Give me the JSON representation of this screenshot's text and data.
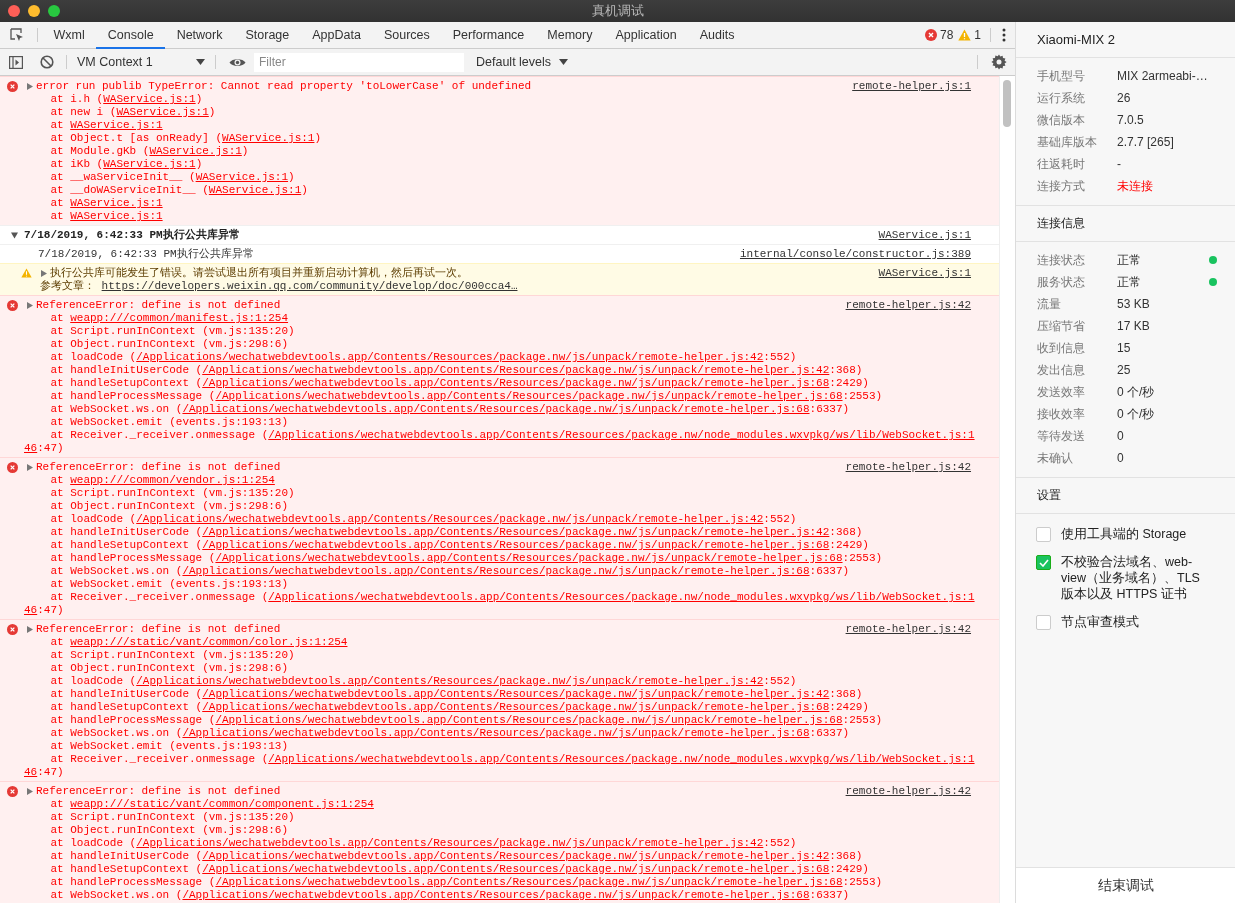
{
  "window": {
    "title": "真机调试"
  },
  "tabs": [
    {
      "label": "Wxml",
      "selected": false
    },
    {
      "label": "Console",
      "selected": true
    },
    {
      "label": "Network",
      "selected": false
    },
    {
      "label": "Storage",
      "selected": false
    },
    {
      "label": "AppData",
      "selected": false
    },
    {
      "label": "Sources",
      "selected": false
    },
    {
      "label": "Performance",
      "selected": false
    },
    {
      "label": "Memory",
      "selected": false
    },
    {
      "label": "Application",
      "selected": false
    },
    {
      "label": "Audits",
      "selected": false
    }
  ],
  "counts": {
    "errors": "78",
    "warnings": "1"
  },
  "toolbar": {
    "context": "VM Context 1",
    "filter_placeholder": "Filter",
    "levels": "Default levels"
  },
  "console": [
    {
      "kind": "error",
      "expanded": false,
      "text": "error run publib TypeError: Cannot read property 'toLowerCase' of undefined",
      "source": "remote-helper.js:1",
      "stack": [
        {
          "kind": "frame",
          "text": "at i.h (",
          "link": "WAService.js:1",
          "after": ")"
        },
        {
          "kind": "frame",
          "text": "at new i (",
          "link": "WAService.js:1",
          "after": ")"
        },
        {
          "kind": "frame",
          "text": "at ",
          "link": "WAService.js:1"
        },
        {
          "kind": "frame",
          "text": "at Object.t [as onReady] (",
          "link": "WAService.js:1",
          "after": ")"
        },
        {
          "kind": "frame",
          "text": "at Module.gKb (",
          "link": "WAService.js:1",
          "after": ")"
        },
        {
          "kind": "frame",
          "text": "at iKb (",
          "link": "WAService.js:1",
          "after": ")"
        },
        {
          "kind": "frame",
          "text": "at __waServiceInit__ (",
          "link": "WAService.js:1",
          "after": ")"
        },
        {
          "kind": "frame",
          "text": "at __doWAServiceInit__ (",
          "link": "WAService.js:1",
          "after": ")"
        },
        {
          "kind": "frame",
          "text": "at ",
          "link": "WAService.js:1"
        },
        {
          "kind": "frame",
          "text": "at ",
          "link": "WAService.js:1"
        }
      ]
    },
    {
      "kind": "group",
      "expanded": true,
      "text": "7/18/2019, 6:42:33 PM执行公共库异常",
      "source": "WAService.js:1",
      "children": [
        {
          "kind": "log",
          "text": "7/18/2019, 6:42:33 PM执行公共库异常",
          "source": "internal/console/constructor.js:389"
        },
        {
          "kind": "warning",
          "expanded": false,
          "text": "执行公共库可能发生了错误。请尝试退出所有项目并重新启动计算机，然后再试一次。",
          "ref_label": "参考文章：",
          "ref_link": "https://developers.weixin.qq.com/community/develop/doc/000cca4…",
          "source": "WAService.js:1"
        }
      ]
    },
    {
      "kind": "error",
      "expanded": false,
      "text": "ReferenceError: define is not defined",
      "source": "remote-helper.js:42",
      "stack": [
        {
          "kind": "frame",
          "text": "at ",
          "link": "weapp:///common/manifest.js:1:254"
        },
        {
          "kind": "frame",
          "text": "at Script.runInContext (vm.js:135:20)"
        },
        {
          "kind": "frame",
          "text": "at Object.runInContext (vm.js:298:6)"
        },
        {
          "kind": "frame",
          "text": "at loadCode (",
          "link": "/Applications/wechatwebdevtools.app/Contents/Resources/package.nw/js/unpack/remote-helper.js:42",
          "after": ":552)"
        },
        {
          "kind": "frame",
          "text": "at handleInitUserCode (",
          "link": "/Applications/wechatwebdevtools.app/Contents/Resources/package.nw/js/unpack/remote-helper.js:42",
          "after": ":368)"
        },
        {
          "kind": "frame",
          "text": "at handleSetupContext (",
          "link": "/Applications/wechatwebdevtools.app/Contents/Resources/package.nw/js/unpack/remote-helper.js:68",
          "after": ":2429)"
        },
        {
          "kind": "frame",
          "text": "at handleProcessMessage (",
          "link": "/Applications/wechatwebdevtools.app/Contents/Resources/package.nw/js/unpack/remote-helper.js:68",
          "after": ":2553)"
        },
        {
          "kind": "frame",
          "text": "at WebSocket.ws.on (",
          "link": "/Applications/wechatwebdevtools.app/Contents/Resources/package.nw/js/unpack/remote-helper.js:68",
          "after": ":6337)"
        },
        {
          "kind": "frame",
          "text": "at WebSocket.emit (events.js:193:13)"
        },
        {
          "kind": "frame",
          "text": "at Receiver._receiver.onmessage (",
          "link": "/Applications/wechatwebdevtools.app/Contents/Resources/package.nw/node_modules.wxvpkg/ws/lib/WebSocket.js:1"
        },
        {
          "kind": "continuation",
          "link": "46",
          "after": ":47)"
        }
      ]
    },
    {
      "kind": "error",
      "expanded": false,
      "text": "ReferenceError: define is not defined",
      "source": "remote-helper.js:42",
      "stack": [
        {
          "kind": "frame",
          "text": "at ",
          "link": "weapp:///common/vendor.js:1:254"
        },
        {
          "kind": "frame",
          "text": "at Script.runInContext (vm.js:135:20)"
        },
        {
          "kind": "frame",
          "text": "at Object.runInContext (vm.js:298:6)"
        },
        {
          "kind": "frame",
          "text": "at loadCode (",
          "link": "/Applications/wechatwebdevtools.app/Contents/Resources/package.nw/js/unpack/remote-helper.js:42",
          "after": ":552)"
        },
        {
          "kind": "frame",
          "text": "at handleInitUserCode (",
          "link": "/Applications/wechatwebdevtools.app/Contents/Resources/package.nw/js/unpack/remote-helper.js:42",
          "after": ":368)"
        },
        {
          "kind": "frame",
          "text": "at handleSetupContext (",
          "link": "/Applications/wechatwebdevtools.app/Contents/Resources/package.nw/js/unpack/remote-helper.js:68",
          "after": ":2429)"
        },
        {
          "kind": "frame",
          "text": "at handleProcessMessage (",
          "link": "/Applications/wechatwebdevtools.app/Contents/Resources/package.nw/js/unpack/remote-helper.js:68",
          "after": ":2553)"
        },
        {
          "kind": "frame",
          "text": "at WebSocket.ws.on (",
          "link": "/Applications/wechatwebdevtools.app/Contents/Resources/package.nw/js/unpack/remote-helper.js:68",
          "after": ":6337)"
        },
        {
          "kind": "frame",
          "text": "at WebSocket.emit (events.js:193:13)"
        },
        {
          "kind": "frame",
          "text": "at Receiver._receiver.onmessage (",
          "link": "/Applications/wechatwebdevtools.app/Contents/Resources/package.nw/node_modules.wxvpkg/ws/lib/WebSocket.js:1"
        },
        {
          "kind": "continuation",
          "link": "46",
          "after": ":47)"
        }
      ]
    },
    {
      "kind": "error",
      "expanded": false,
      "text": "ReferenceError: define is not defined",
      "source": "remote-helper.js:42",
      "stack": [
        {
          "kind": "frame",
          "text": "at ",
          "link": "weapp:///static/vant/common/color.js:1:254"
        },
        {
          "kind": "frame",
          "text": "at Script.runInContext (vm.js:135:20)"
        },
        {
          "kind": "frame",
          "text": "at Object.runInContext (vm.js:298:6)"
        },
        {
          "kind": "frame",
          "text": "at loadCode (",
          "link": "/Applications/wechatwebdevtools.app/Contents/Resources/package.nw/js/unpack/remote-helper.js:42",
          "after": ":552)"
        },
        {
          "kind": "frame",
          "text": "at handleInitUserCode (",
          "link": "/Applications/wechatwebdevtools.app/Contents/Resources/package.nw/js/unpack/remote-helper.js:42",
          "after": ":368)"
        },
        {
          "kind": "frame",
          "text": "at handleSetupContext (",
          "link": "/Applications/wechatwebdevtools.app/Contents/Resources/package.nw/js/unpack/remote-helper.js:68",
          "after": ":2429)"
        },
        {
          "kind": "frame",
          "text": "at handleProcessMessage (",
          "link": "/Applications/wechatwebdevtools.app/Contents/Resources/package.nw/js/unpack/remote-helper.js:68",
          "after": ":2553)"
        },
        {
          "kind": "frame",
          "text": "at WebSocket.ws.on (",
          "link": "/Applications/wechatwebdevtools.app/Contents/Resources/package.nw/js/unpack/remote-helper.js:68",
          "after": ":6337)"
        },
        {
          "kind": "frame",
          "text": "at WebSocket.emit (events.js:193:13)"
        },
        {
          "kind": "frame",
          "text": "at Receiver._receiver.onmessage (",
          "link": "/Applications/wechatwebdevtools.app/Contents/Resources/package.nw/node_modules.wxvpkg/ws/lib/WebSocket.js:1"
        },
        {
          "kind": "continuation",
          "link": "46",
          "after": ":47)"
        }
      ]
    },
    {
      "kind": "error",
      "expanded": false,
      "text": "ReferenceError: define is not defined",
      "source": "remote-helper.js:42",
      "stack": [
        {
          "kind": "frame",
          "text": "at ",
          "link": "weapp:///static/vant/common/component.js:1:254"
        },
        {
          "kind": "frame",
          "text": "at Script.runInContext (vm.js:135:20)"
        },
        {
          "kind": "frame",
          "text": "at Object.runInContext (vm.js:298:6)"
        },
        {
          "kind": "frame",
          "text": "at loadCode (",
          "link": "/Applications/wechatwebdevtools.app/Contents/Resources/package.nw/js/unpack/remote-helper.js:42",
          "after": ":552)"
        },
        {
          "kind": "frame",
          "text": "at handleInitUserCode (",
          "link": "/Applications/wechatwebdevtools.app/Contents/Resources/package.nw/js/unpack/remote-helper.js:42",
          "after": ":368)"
        },
        {
          "kind": "frame",
          "text": "at handleSetupContext (",
          "link": "/Applications/wechatwebdevtools.app/Contents/Resources/package.nw/js/unpack/remote-helper.js:68",
          "after": ":2429)"
        },
        {
          "kind": "frame",
          "text": "at handleProcessMessage (",
          "link": "/Applications/wechatwebdevtools.app/Contents/Resources/package.nw/js/unpack/remote-helper.js:68",
          "after": ":2553)"
        },
        {
          "kind": "frame",
          "text": "at WebSocket.ws.on (",
          "link": "/Applications/wechatwebdevtools.app/Contents/Resources/package.nw/js/unpack/remote-helper.js:68",
          "after": ":6337)"
        }
      ]
    }
  ],
  "sidebar": {
    "device": "Xiaomi-MIX 2",
    "info": [
      {
        "label": "手机型号",
        "value": "MIX 2armeabi-…",
        "alert": false
      },
      {
        "label": "运行系统",
        "value": "26",
        "alert": false
      },
      {
        "label": "微信版本",
        "value": "7.0.5",
        "alert": false
      },
      {
        "label": "基础库版本",
        "value": "2.7.7 [265]",
        "alert": false
      },
      {
        "label": "往返耗时",
        "value": "-",
        "alert": false
      },
      {
        "label": "连接方式",
        "value": "未连接",
        "alert": true
      }
    ],
    "connection_title": "连接信息",
    "connection": [
      {
        "label": "连接状态",
        "value": "正常",
        "color": "#19c35f"
      },
      {
        "label": "服务状态",
        "value": "正常",
        "color": "#19c35f"
      },
      {
        "label": "流量",
        "value": "53 KB"
      },
      {
        "label": "压缩节省",
        "value": "17 KB"
      },
      {
        "label": "收到信息",
        "value": "15"
      },
      {
        "label": "发出信息",
        "value": "25"
      },
      {
        "label": "发送效率",
        "value": "0 个/秒"
      },
      {
        "label": "接收效率",
        "value": "0 个/秒"
      },
      {
        "label": "等待发送",
        "value": "0"
      },
      {
        "label": "未确认",
        "value": "0"
      }
    ],
    "settings_title": "设置",
    "settings": [
      {
        "label": "使用工具端的 Storage",
        "checked": false
      },
      {
        "label": "不校验合法域名、web-view（业务域名）、TLS 版本以及 HTTPS 证书",
        "checked": true
      },
      {
        "label": "节点审查模式",
        "checked": false
      }
    ],
    "end_button": "结束调试"
  }
}
